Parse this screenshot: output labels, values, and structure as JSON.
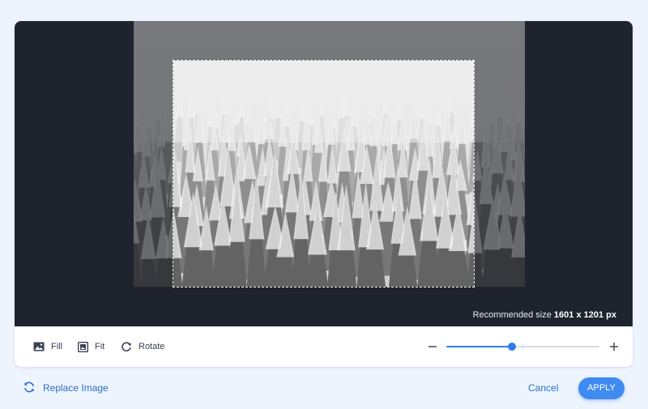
{
  "editor": {
    "recommended_label": "Recommended size",
    "recommended_value": "1601 x 1201 px"
  },
  "toolbar": {
    "fill_label": "Fill",
    "fit_label": "Fit",
    "rotate_label": "Rotate",
    "zoom_level": 0.43
  },
  "footer": {
    "replace_label": "Replace Image",
    "cancel_label": "Cancel",
    "apply_label": "APPLY"
  },
  "colors": {
    "accent": "#2f7be6",
    "canvas_bg": "#1f232d",
    "page_bg": "#eef4fd"
  },
  "icons": {
    "fill": "image-icon",
    "fit": "image-frame-icon",
    "rotate": "rotate-icon",
    "replace": "refresh-icon",
    "zoom_out": "minus-icon",
    "zoom_in": "plus-icon"
  }
}
